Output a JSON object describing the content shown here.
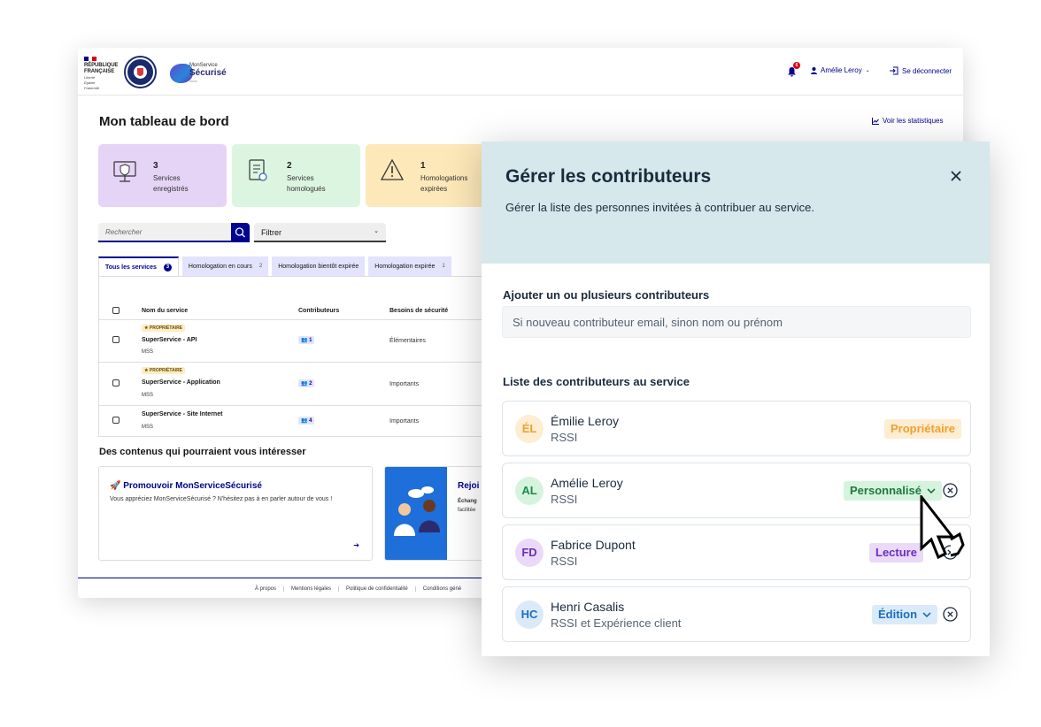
{
  "header": {
    "rf": [
      "RÉPUBLIQUE",
      "FRANÇAISE"
    ],
    "motto": [
      "Liberté",
      "Égalité",
      "Fraternité"
    ],
    "logo": {
      "line1": "MonService",
      "line2": "Sécurisé",
      "line3": "ANSSI"
    },
    "notif_count": "6",
    "user_name": "Amélie Leroy",
    "logout_label": "Se déconnecter"
  },
  "dashboard": {
    "title": "Mon tableau de bord",
    "stats_link": "Voir les statistiques",
    "cards": [
      {
        "num": "3",
        "l1": "Services",
        "l2": "enregistrés",
        "bg": "#e5d4f6",
        "icon": "server-shield-icon"
      },
      {
        "num": "2",
        "l1": "Services",
        "l2": "homologués",
        "bg": "#dcf5e1",
        "icon": "certified-document-icon"
      },
      {
        "num": "1",
        "l1": "Homologations",
        "l2": "expirées",
        "bg": "#fde8b9",
        "icon": "warning-triangle-icon"
      }
    ],
    "search_placeholder": "Rechercher",
    "filter_label": "Filtrer",
    "tabs": [
      {
        "label": "Tous les services",
        "count": "3"
      },
      {
        "label": "Homologation en cours",
        "count": "2"
      },
      {
        "label": "Homologation bientôt expirée",
        "count": ""
      },
      {
        "label": "Homologation expirée",
        "count": "1"
      }
    ],
    "table": {
      "columns": [
        "Nom du service",
        "Contributeurs",
        "Besoins de sécurité"
      ],
      "rows": [
        {
          "badge": "PROPRIÉTAIRE",
          "name": "SuperService - API",
          "org": "MSS",
          "contributors": "1",
          "needs": "Élémentaires"
        },
        {
          "badge": "PROPRIÉTAIRE",
          "name": "SuperService - Application",
          "org": "MSS",
          "contributors": "2",
          "needs": "Importants"
        },
        {
          "badge": "",
          "name": "SuperService - Site Internet",
          "org": "MSS",
          "contributors": "4",
          "needs": "Importants"
        }
      ]
    },
    "contents_title": "Des contenus qui pourraient vous intéresser",
    "promo1": {
      "title": "🚀 Promouvoir MonServiceSécurisé",
      "desc": "Vous appréciez MonServiceSécurisé ? N'hésitez pas à en parler autour de vous !"
    },
    "promo2": {
      "title": "Rejoi",
      "desc1": "Échang",
      "desc2": "facilitée"
    },
    "footer": [
      "À propos",
      "Mentions légales",
      "Politique de confidentialité",
      "Conditions géné"
    ]
  },
  "panel": {
    "title": "Gérer les contributeurs",
    "subtitle": "Gérer la liste des personnes invitées à contribuer au service.",
    "add_label": "Ajouter un ou plusieurs contributeurs",
    "add_placeholder": "Si nouveau contributeur email, sinon nom ou prénom",
    "list_label": "Liste des contributeurs au service",
    "contributors": [
      {
        "initials": "ÉL",
        "name": "Émilie Leroy",
        "role": "RSSI",
        "access": "Propriétaire",
        "color": "#f0a030"
      },
      {
        "initials": "AL",
        "name": "Amélie Leroy",
        "role": "RSSI",
        "access": "Personnalisé",
        "color": "#1e8a4a"
      },
      {
        "initials": "FD",
        "name": "Fabrice Dupont",
        "role": "RSSI",
        "access": "Lecture",
        "color": "#6a2fb8"
      },
      {
        "initials": "HC",
        "name": "Henri Casalis",
        "role": "RSSI et Expérience client",
        "access": "Édition",
        "color": "#1a6fc0"
      }
    ]
  }
}
